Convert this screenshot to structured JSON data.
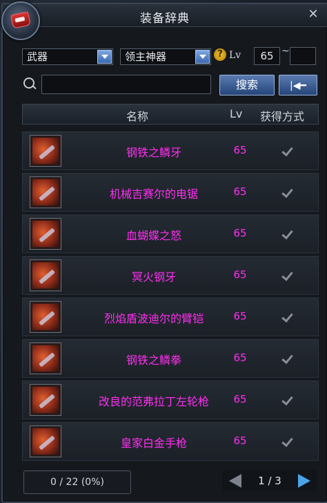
{
  "window": {
    "title": "装备辞典"
  },
  "filters": {
    "category": "武器",
    "subcategory": "领主神器",
    "level_label": "Lv",
    "level_min": "65",
    "level_tilde": "~",
    "level_max": ""
  },
  "search": {
    "button_label": "搜索",
    "back_glyph": "|◀━"
  },
  "table": {
    "headers": {
      "name": "名称",
      "lv": "Lv",
      "obtain": "获得方式"
    },
    "rows": [
      {
        "name": "钢铁之鳞牙",
        "lv": "65"
      },
      {
        "name": "机械吉赛尔的电锯",
        "lv": "65"
      },
      {
        "name": "血蝴蝶之怒",
        "lv": "65"
      },
      {
        "name": "冥火钢牙",
        "lv": "65"
      },
      {
        "name": "烈焰盾波迪尔的臂铠",
        "lv": "65"
      },
      {
        "name": "钢铁之鳞拳",
        "lv": "65"
      },
      {
        "name": "改良的范弗拉丁左轮枪",
        "lv": "65"
      },
      {
        "name": "皇家白金手枪",
        "lv": "65"
      }
    ]
  },
  "footer": {
    "count": "0 / 22 (0%)",
    "page": "1 / 3"
  },
  "colors": {
    "item_name": "#ff2ef0",
    "accent_blue": "#4aa4ea"
  },
  "icons": [
    "book-icon",
    "close-icon",
    "dropdown-arrow-icon",
    "help-icon",
    "search-icon",
    "back-icon",
    "checkmark-icon",
    "prev-page-icon",
    "next-page-icon"
  ]
}
